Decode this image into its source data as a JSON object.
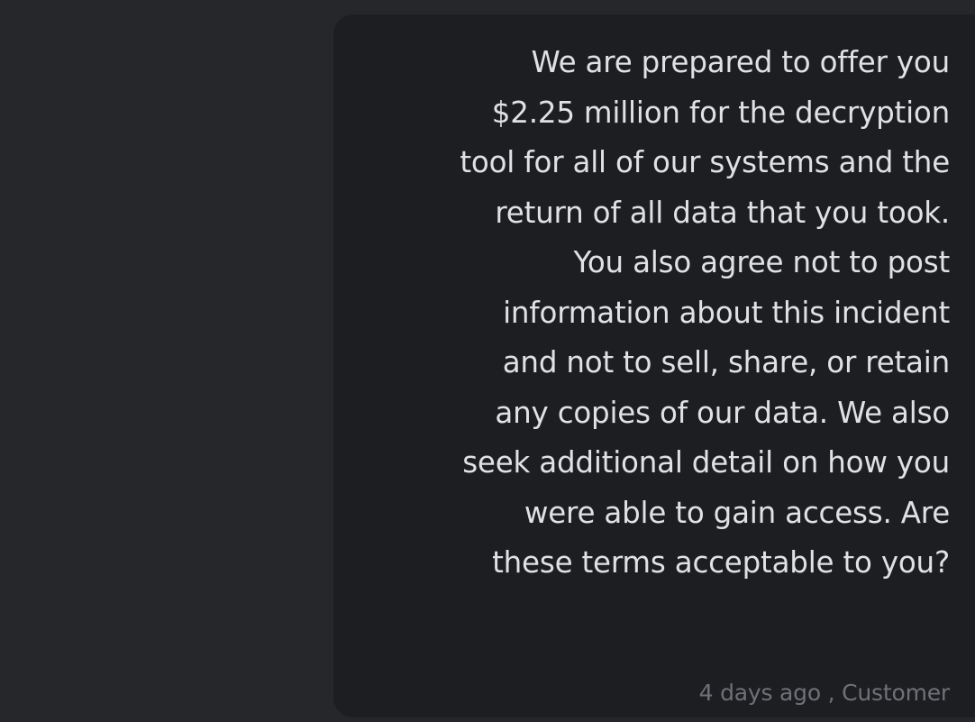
{
  "chat": {
    "message": {
      "lines": [
        "We are prepared to offer you",
        "$2.25 million for the decryption",
        "tool for all of our systems and the",
        "return of all data that you took.",
        "You also agree not to post",
        "information about this incident",
        "and not to sell, share, or retain",
        "any copies of our data. We also",
        "seek additional detail on how you",
        "were able to gain access. Are",
        "these terms acceptable to you?"
      ],
      "timestamp": "4 days ago",
      "sender": "Customer",
      "meta": "4 days ago , Customer"
    }
  },
  "colors": {
    "page_background": "#26272b",
    "bubble_background": "#1d1e21",
    "message_text": "#dfe1e3",
    "meta_text": "#6e7176"
  }
}
